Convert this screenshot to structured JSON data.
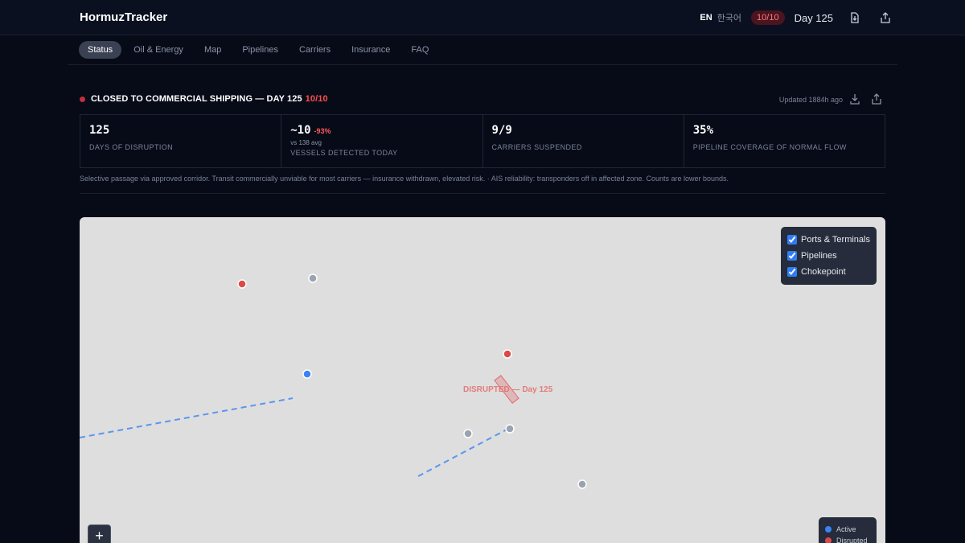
{
  "app": {
    "title": "HormuzTracker"
  },
  "topbar": {
    "lang_en": "EN",
    "lang_ko": "한국어",
    "severity_badge": "10/10",
    "day_label": "Day 125",
    "icons": [
      "download-icon",
      "share-icon"
    ]
  },
  "nav": {
    "tabs": [
      {
        "label": "Status",
        "active": true
      },
      {
        "label": "Oil & Energy",
        "active": false
      },
      {
        "label": "Map",
        "active": false
      },
      {
        "label": "Pipelines",
        "active": false
      },
      {
        "label": "Carriers",
        "active": false
      },
      {
        "label": "Insurance",
        "active": false
      },
      {
        "label": "FAQ",
        "active": false
      }
    ]
  },
  "status": {
    "title": "CLOSED TO COMMERCIAL SHIPPING — DAY 125",
    "severity": "10/10",
    "updated": "Updated 1884h ago",
    "status_color": "#c0303c"
  },
  "stats": [
    {
      "value": "125",
      "delta": "",
      "sub": "",
      "label": "DAYS OF DISRUPTION"
    },
    {
      "value": "~10",
      "delta": "-93%",
      "sub": "vs 138 avg",
      "label": "VESSELS DETECTED TODAY"
    },
    {
      "value": "9/9",
      "delta": "",
      "sub": "",
      "label": "CARRIERS SUSPENDED"
    },
    {
      "value": "35%",
      "delta": "",
      "sub": "",
      "label": "PIPELINE COVERAGE OF NORMAL FLOW"
    }
  ],
  "note": "Selective passage via approved corridor. Transit commercially unviable for most carriers — insurance withdrawn, elevated risk. · AIS reliability: transponders off in affected zone. Counts are lower bounds.",
  "map": {
    "chokepoint_label": "DISRUPTED — Day 125",
    "layers": [
      {
        "label": "Ports & Terminals",
        "checked": true
      },
      {
        "label": "Pipelines",
        "checked": true
      },
      {
        "label": "Chokepoint",
        "checked": true
      }
    ],
    "zoom_in_label": "+",
    "legend": [
      {
        "label": "Active",
        "color": "#3b82f6"
      },
      {
        "label": "Disrupted",
        "color": "#e04848"
      }
    ],
    "colors": {
      "active": "#3b82f6",
      "disrupted": "#e04848",
      "inactive": "#9aa3b2",
      "pipeline": "#5b95ee"
    }
  }
}
